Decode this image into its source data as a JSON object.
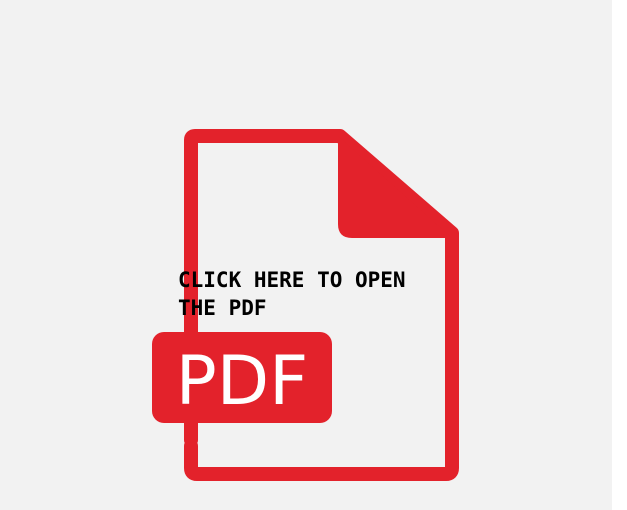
{
  "link": {
    "text": "CLICK HERE TO OPEN\nTHE PDF"
  },
  "icon": {
    "name": "pdf-file-icon",
    "badge_text": "PDF"
  },
  "colors": {
    "background": "#f2f2f2",
    "accent": "#e3222b",
    "text": "#000000"
  }
}
